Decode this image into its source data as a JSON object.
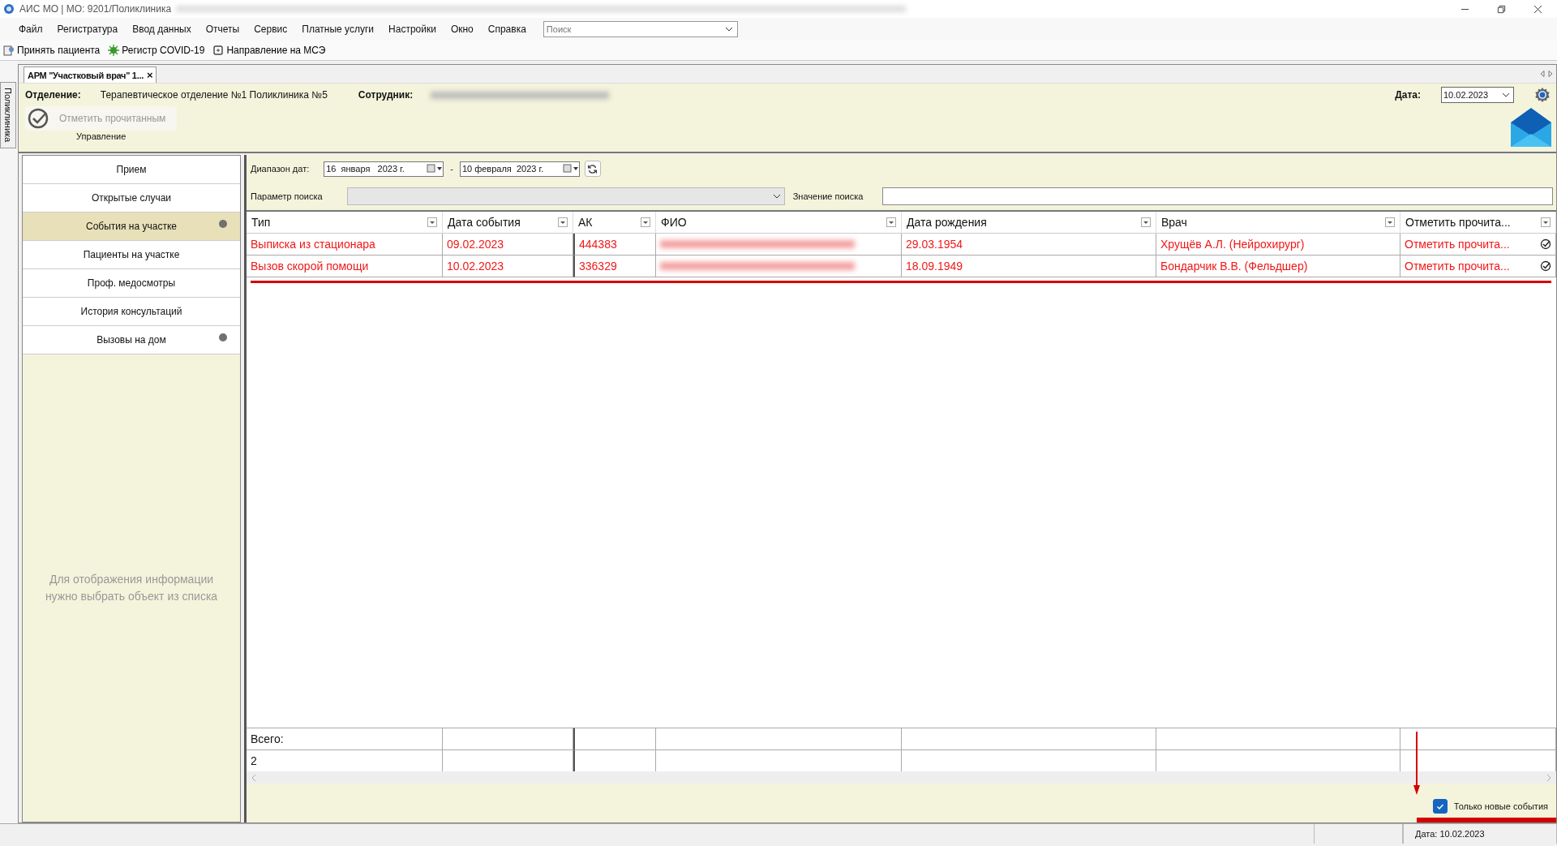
{
  "window": {
    "title": "АИС МО | МО: 9201/Поликлиника"
  },
  "menu": [
    "Файл",
    "Регистратура",
    "Ввод данных",
    "Отчеты",
    "Сервис",
    "Платные услуги",
    "Настройки",
    "Окно",
    "Справка"
  ],
  "menu_search": {
    "placeholder": "Поиск"
  },
  "toolbar": [
    "Принять пациента",
    "Регистр COVID-19",
    "Направление на МСЭ"
  ],
  "side_tab": "Поликлиника",
  "doc_tab": {
    "label": "АРМ \"Участковый врач\" 1...",
    "close": "×"
  },
  "header": {
    "department_label": "Отделение:",
    "department": "Терапевтическое отделение №1 Поликлиника №5",
    "employee_label": "Сотрудник:",
    "date_label": "Дата:",
    "date": "10.02.2023",
    "mark_read_button": "Отметить прочитанным",
    "group_label": "Управление"
  },
  "sidebar": {
    "items": [
      {
        "label": "Прием",
        "selected": false,
        "dot": false
      },
      {
        "label": "Открытые случаи",
        "selected": false,
        "dot": false
      },
      {
        "label": "События на участке",
        "selected": true,
        "dot": true
      },
      {
        "label": "Пациенты на участке",
        "selected": false,
        "dot": false
      },
      {
        "label": "Проф. медосмотры",
        "selected": false,
        "dot": false
      },
      {
        "label": "История консультаций",
        "selected": false,
        "dot": false
      },
      {
        "label": "Вызовы на дом",
        "selected": false,
        "dot": true
      }
    ],
    "empty_hint": "Для отображения информации нужно выбрать объект из списка"
  },
  "filters": {
    "range_label": "Диапазон дат:",
    "from": "16  января   2023 г.",
    "separator": "-",
    "to": "10 февраля  2023 г.",
    "param_label": "Параметр поиска",
    "value_label": "Значение поиска"
  },
  "table": {
    "columns": [
      "Тип",
      "Дата события",
      "АК",
      "ФИО",
      "Дата рождения",
      "Врач",
      "Отметить  прочита..."
    ],
    "rows": [
      {
        "type": "Выписка из стационара",
        "date": "09.02.2023",
        "ak": "444383",
        "dob": "29.03.1954",
        "doctor": "Хрущёв А.Л. (Нейрохирург)",
        "mark": "Отметить  прочита...",
        "unread": true
      },
      {
        "type": "Вызов скорой помощи",
        "date": "10.02.2023",
        "ak": "336329",
        "dob": "18.09.1949",
        "doctor": "Бондарчик В.В. (Фельдшер)",
        "mark": "Отметить  прочита...",
        "unread": true
      }
    ],
    "total_label": "Всего:",
    "total": "2"
  },
  "only_new": {
    "label": "Только новые события",
    "checked": true
  },
  "status_bar": {
    "date": "Дата: 10.02.2023"
  }
}
